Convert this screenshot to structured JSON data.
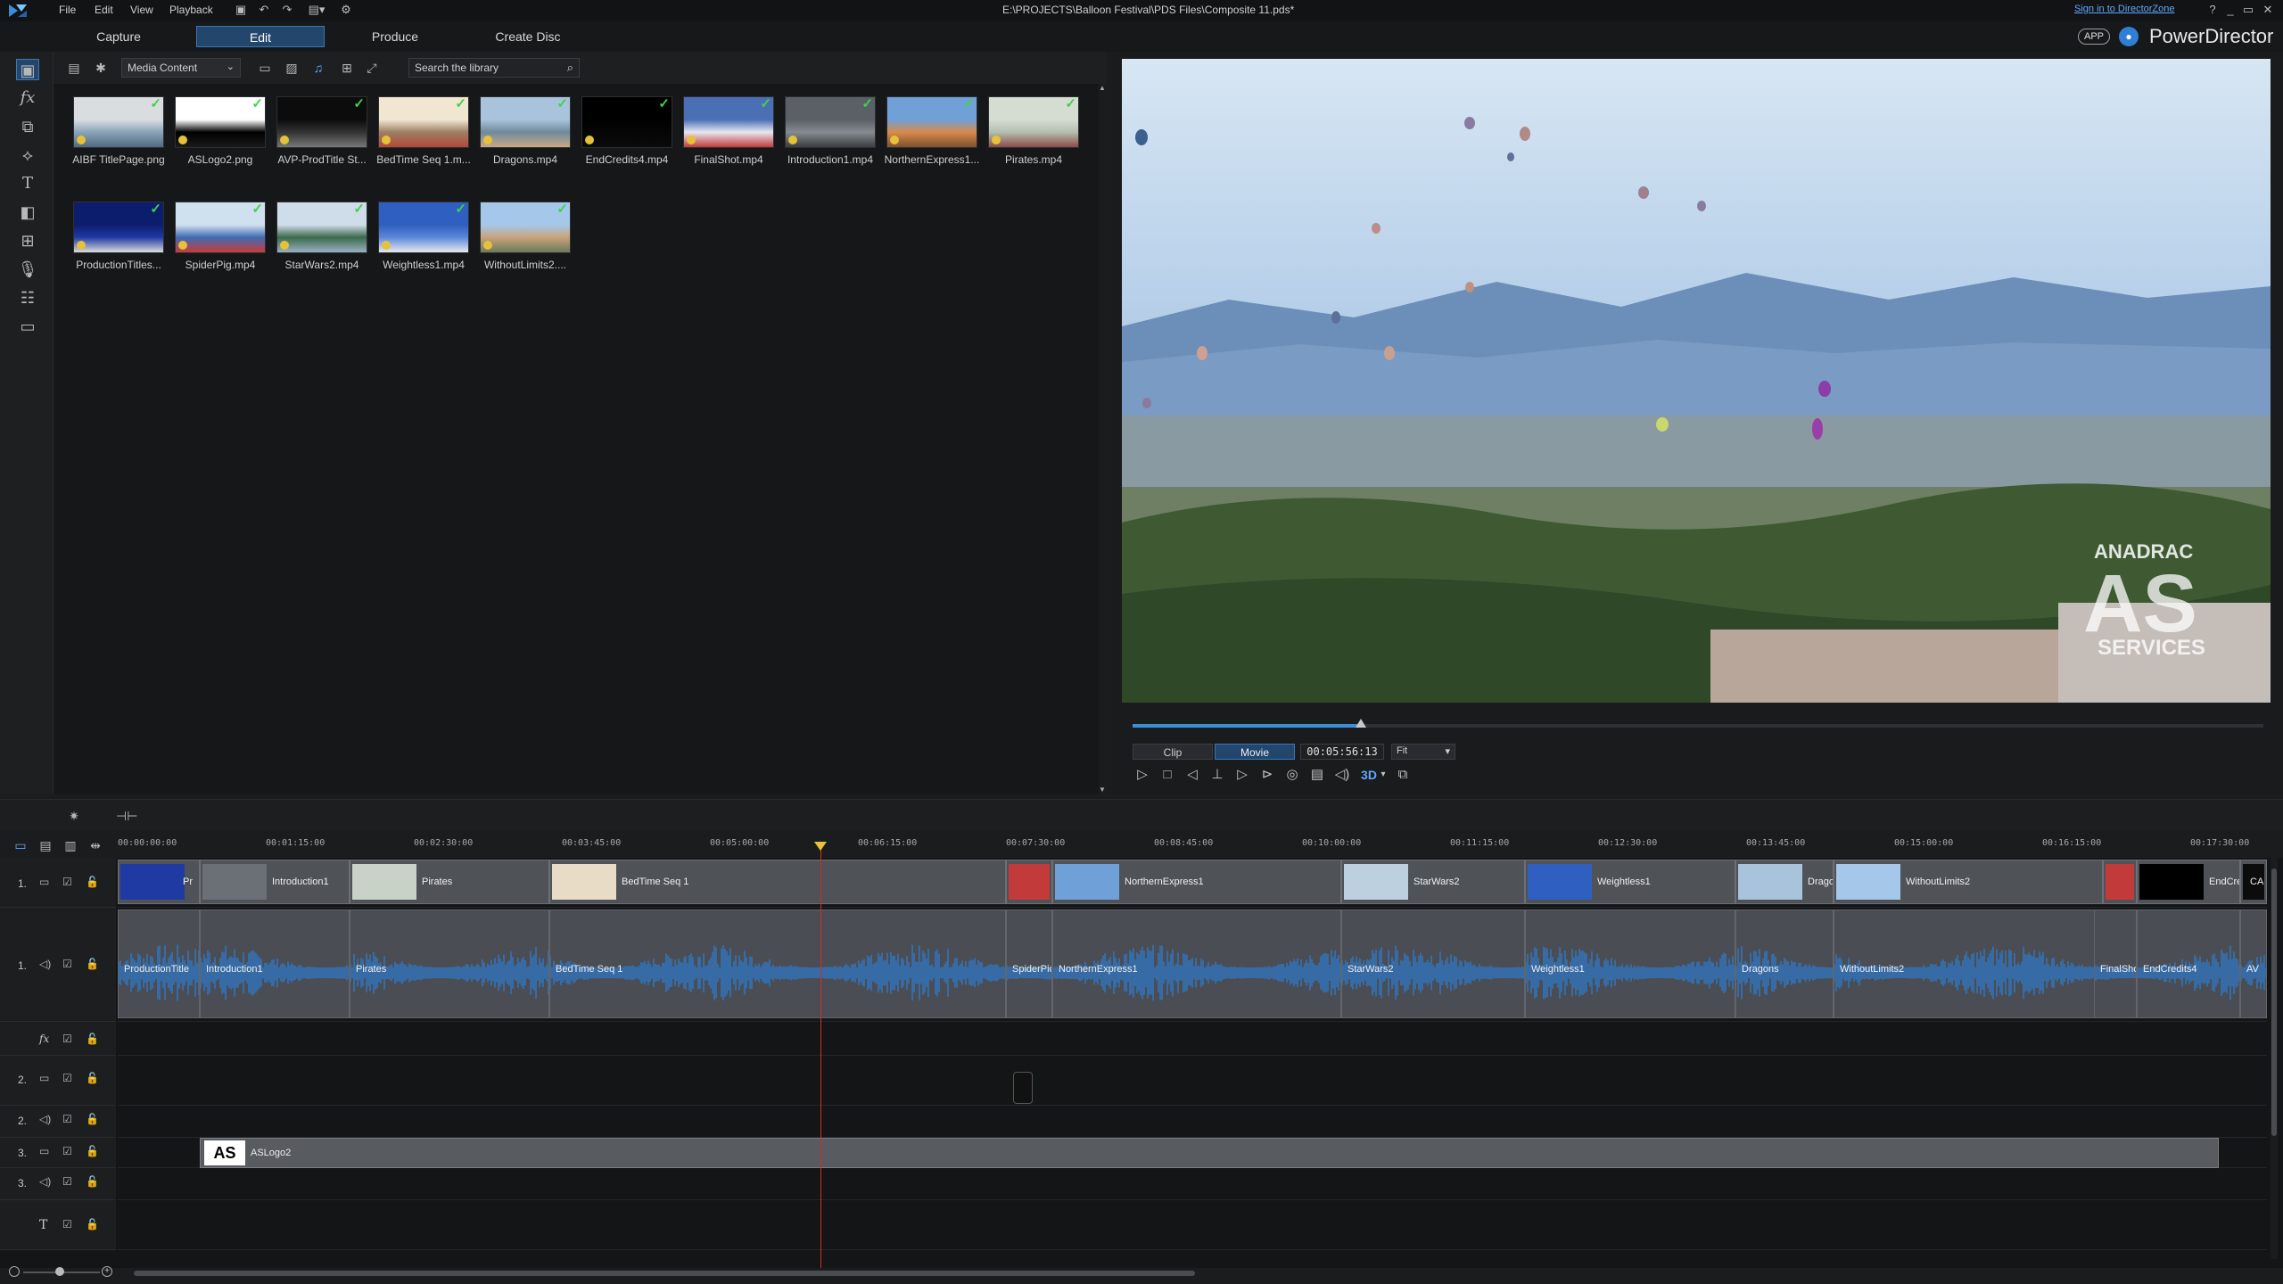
{
  "menu": [
    "File",
    "Edit",
    "View",
    "Playback"
  ],
  "window": {
    "title": "E:\\PROJECTS\\Balloon Festival\\PDS Files\\Composite 11.pds*",
    "sign_in": "Sign in to DirectorZone",
    "app_badge": "APP",
    "brand": "PowerDirector",
    "controls": [
      "?",
      "_",
      "▭",
      "✕"
    ]
  },
  "tabs": [
    "Capture",
    "Edit",
    "Produce",
    "Create Disc"
  ],
  "active_tab": "Edit",
  "library": {
    "filter": "Media Content",
    "search_placeholder": "Search the library",
    "items": [
      {
        "label": "AIBF TitlePage.png",
        "colors": [
          "#d9dde0",
          "#8aa3b8",
          "#4f6a80"
        ]
      },
      {
        "label": "ASLogo2.png",
        "colors": [
          "#ffffff",
          "#000000",
          "#1a1a1a"
        ]
      },
      {
        "label": "AVP-ProdTitle St...",
        "colors": [
          "#0c0c0c",
          "#333",
          "#777"
        ]
      },
      {
        "label": "BedTime Seq 1.m...",
        "colors": [
          "#f0e6d2",
          "#9d7f63",
          "#b3483a"
        ]
      },
      {
        "label": "Dragons.mp4",
        "colors": [
          "#a9c3dc",
          "#6f8a9c",
          "#c9a886"
        ]
      },
      {
        "label": "EndCredits4.mp4",
        "colors": [
          "#000000",
          "#050505",
          "#0a0a0a"
        ]
      },
      {
        "label": "FinalShot.mp4",
        "colors": [
          "#4a6fb5",
          "#e7e7ef",
          "#c23a3a"
        ]
      },
      {
        "label": "Introduction1.mp4",
        "colors": [
          "#5b6066",
          "#868b91",
          "#3a3e42"
        ]
      },
      {
        "label": "NorthernExpress1...",
        "colors": [
          "#6fa0d8",
          "#d98a4a",
          "#7b5130"
        ]
      },
      {
        "label": "Pirates.mp4",
        "colors": [
          "#d5dcd2",
          "#b3bfae",
          "#8c4a4a"
        ]
      },
      {
        "label": "ProductionTitles...",
        "colors": [
          "#0d1d6e",
          "#1f3aa3",
          "#dcdcdc"
        ]
      },
      {
        "label": "SpiderPig.mp4",
        "colors": [
          "#cfe0ee",
          "#3f6bb3",
          "#c93a3a"
        ]
      },
      {
        "label": "StarWars2.mp4",
        "colors": [
          "#cfdcea",
          "#3a6a4a",
          "#9bb0c6"
        ]
      },
      {
        "label": "Weightless1.mp4",
        "colors": [
          "#2f5fc0",
          "#5a88d8",
          "#e8e8f0"
        ]
      },
      {
        "label": "WithoutLimits2....",
        "colors": [
          "#a5c8ea",
          "#c9a27a",
          "#6b7a5b"
        ]
      }
    ]
  },
  "preview": {
    "watermark": [
      "ANADRAC",
      "AS",
      "SERVICES"
    ],
    "mode_clip": "Clip",
    "mode_movie": "Movie",
    "active_mode": "Movie",
    "timecode": "00:05:56:13",
    "fit": "Fit",
    "progress": 0.202,
    "badge_3d": "3D"
  },
  "timeline": {
    "ruler": [
      "00:00:00:00",
      "00:01:15:00",
      "00:02:30:00",
      "00:03:45:00",
      "00:05:00:00",
      "00:06:15:00",
      "00:07:30:00",
      "00:08:45:00",
      "00:10:00:00",
      "00:11:15:00",
      "00:12:30:00",
      "00:13:45:00",
      "00:15:00:00",
      "00:16:15:00",
      "00:17:30:00"
    ],
    "tracks": [
      "1.",
      "1.",
      "fx",
      "2.",
      "2.",
      "3.",
      "3.",
      "T"
    ],
    "video_clips": [
      {
        "name": "Pr",
        "thumb": "#1f3aa3"
      },
      {
        "name": "Introduction1",
        "thumb": "#6a7076"
      },
      {
        "name": "Pirates",
        "thumb": "#c9d2c6"
      },
      {
        "name": "BedTime Seq 1",
        "thumb": "#e9dcc6"
      },
      {
        "name": "",
        "thumb": "#c23a3a"
      },
      {
        "name": "NorthernExpress1",
        "thumb": "#6fa0d8"
      },
      {
        "name": "StarWars2",
        "thumb": "#bcd0e0"
      },
      {
        "name": "Weightless1",
        "thumb": "#2f5fc0"
      },
      {
        "name": "Drago",
        "thumb": "#a9c3dc"
      },
      {
        "name": "WithoutLimits2",
        "thumb": "#a5c8ea"
      },
      {
        "name": "",
        "thumb": "#c23a3a"
      },
      {
        "name": "EndCre",
        "thumb": "#000000"
      },
      {
        "name": "CA",
        "thumb": "#0c0c0c"
      }
    ],
    "audio_clips": [
      "ProductionTitle",
      "Introduction1",
      "Pirates",
      "BedTime Seq 1",
      "SpiderPic",
      "NorthernExpress1",
      "StarWars2",
      "Weightless1",
      "Dragons",
      "WithoutLimits2",
      "FinalSho",
      "EndCredits4",
      "AV"
    ],
    "overlay_clip": "ASLogo2"
  }
}
